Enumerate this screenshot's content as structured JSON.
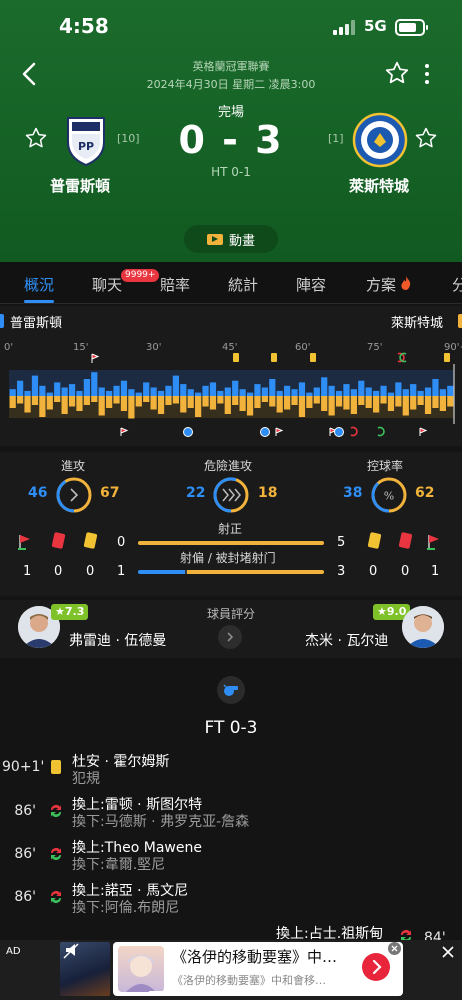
{
  "status_bar": {
    "time": "4:58",
    "network": "5G"
  },
  "match": {
    "league": "英格蘭冠軍聯賽",
    "datetime": "2024年4月30日 星期二 凌晨3:00",
    "status": "完場",
    "score": "0 - 3",
    "halftime": "HT 0-1",
    "animation_label": "動畫",
    "home": {
      "name": "普雷斯頓",
      "rank": "[10]",
      "crest_text": "PP"
    },
    "away": {
      "name": "萊斯特城",
      "rank": "[1]"
    }
  },
  "tabs": [
    {
      "label": "概況",
      "active": true
    },
    {
      "label": "聊天",
      "badge": "9999+"
    },
    {
      "label": "賠率"
    },
    {
      "label": "統計"
    },
    {
      "label": "陣容"
    },
    {
      "label": "方案"
    },
    {
      "label": "分"
    }
  ],
  "timeline": {
    "home_name": "普雷斯頓",
    "away_name": "萊斯特城",
    "ticks": [
      "0'",
      "15'",
      "30'",
      "45'",
      "60'",
      "75'",
      "90'+"
    ],
    "home_color": "#2f8ef5",
    "away_color": "#f1b33b"
  },
  "stats": {
    "attack": {
      "label": "進攻",
      "home": "46",
      "away": "67",
      "home_pct": 0.41
    },
    "danger": {
      "label": "危險進攻",
      "home": "22",
      "away": "18",
      "home_pct": 0.55
    },
    "possession": {
      "label": "控球率",
      "home": "38",
      "away": "62",
      "home_pct": 0.38,
      "symbol": "%"
    },
    "cards_home": {
      "corners": "1",
      "red": "0",
      "yellow": "0"
    },
    "cards_away": {
      "corners": "1",
      "red": "0",
      "yellow": "0"
    },
    "shots_on": {
      "label": "射正",
      "home": "0",
      "away": "5",
      "home_pct": 0.0
    },
    "shots_off": {
      "label": "射偏 / 被封堵射门",
      "home": "1",
      "away": "3",
      "home_pct": 0.25
    }
  },
  "ratings": {
    "title": "球員評分",
    "home": {
      "rating": "★7.3",
      "name": "弗雷迪 · 伍德曼"
    },
    "away": {
      "rating": "★9.0",
      "name": "杰米 · 瓦尔迪"
    }
  },
  "events": {
    "ft": "FT 0-3",
    "items": [
      {
        "minute": "90+1'",
        "main": "杜安 · 霍尔姆斯",
        "sub": "犯規",
        "type": "yellow"
      },
      {
        "minute": "86'",
        "main": "換上:雷顿 · 斯图尔特",
        "sub": "換下:马德斯 · 弗罗克亚-詹森",
        "type": "sub"
      },
      {
        "minute": "86'",
        "main": "換上:Theo Mawene",
        "sub": "換下:韋爾.堅尼",
        "type": "sub"
      },
      {
        "minute": "86'",
        "main": "換上:諾亞 · 馬文尼",
        "sub": "換下:阿倫.布朗尼",
        "type": "sub"
      }
    ],
    "partial": {
      "main": "換上:占士.祖斯甸",
      "minute": "84'"
    }
  },
  "ad": {
    "label": "AD",
    "title": "《洛伊的移動要塞》中…",
    "desc": "《洛伊的移動要塞》中和會移…"
  }
}
